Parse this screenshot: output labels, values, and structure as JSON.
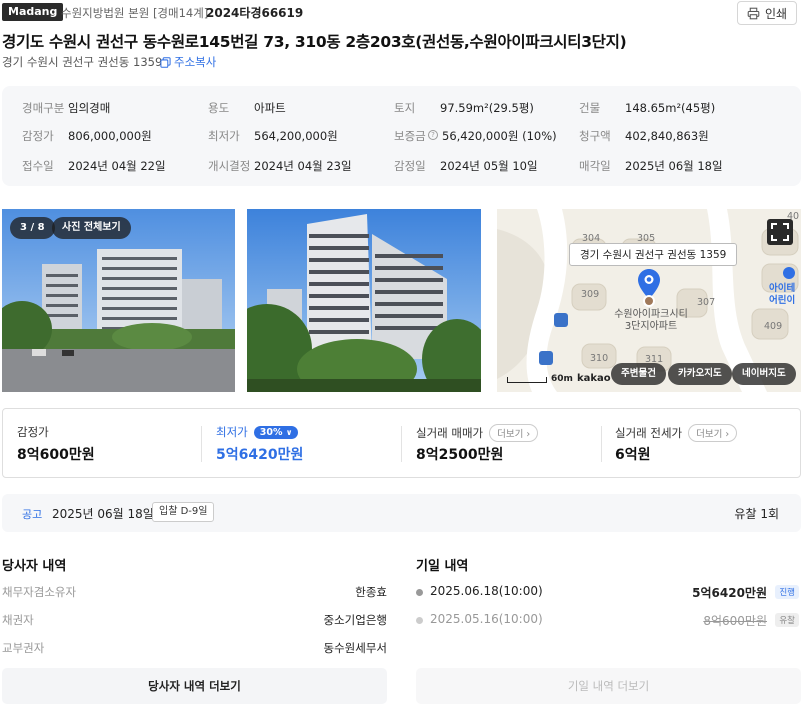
{
  "header": {
    "brand": "Madang",
    "court": "수원지방법원 본원 [경매14계]",
    "case_no": "2024타경66619",
    "print_label": "인쇄"
  },
  "address": {
    "title": "경기도 수원시 권선구 동수원로145번길 73, 310동 2층203호(권선동,수원아이파크시티3단지)",
    "lot": "경기 수원시 권선구 권선동 1359",
    "copy_label": "주소복사"
  },
  "info": [
    [
      {
        "k": "경매구분",
        "v": "임의경매"
      },
      {
        "k": "용도",
        "v": "아파트"
      },
      {
        "k": "토지",
        "v": "97.59m²(29.5평)"
      },
      {
        "k": "건물",
        "v": "148.65m²(45평)"
      }
    ],
    [
      {
        "k": "감정가",
        "v": "806,000,000원"
      },
      {
        "k": "최저가",
        "v": "564,200,000원"
      },
      {
        "k": "보증금",
        "v": "56,420,000원 (10%)"
      },
      {
        "k": "청구액",
        "v": "402,840,863원"
      }
    ],
    [
      {
        "k": "접수일",
        "v": "2024년 04월 22일"
      },
      {
        "k": "개시결정",
        "v": "2024년 04월 23일"
      },
      {
        "k": "감정일",
        "v": "2024년 05월 10일"
      },
      {
        "k": "매각일",
        "v": "2025년 06월 18일"
      }
    ]
  ],
  "photos": {
    "counter": "3 / 8",
    "view_all": "사진 전체보기"
  },
  "map": {
    "address_label": "경기 수원시 권선구 권선동 1359",
    "place_name_line1": "수원아이파크시티",
    "place_name_line2": "3단지아파트",
    "numbers": [
      "304",
      "305",
      "309",
      "307",
      "310",
      "311",
      "409",
      "40"
    ],
    "scale": "60m",
    "provider": "kakao",
    "poi_line1": "아이테",
    "poi_line2": "어린이",
    "buttons": [
      "주변물건",
      "카카오지도",
      "네이버지도"
    ]
  },
  "prices": {
    "appraisal_label": "감정가",
    "appraisal_value": "8억600만원",
    "min_label": "최저가",
    "min_pct": "30%",
    "min_value": "5억6420만원",
    "sale_label": "실거래 매매가",
    "sale_value": "8억2500만원",
    "rent_label": "실거래 전세가",
    "rent_value": "6억원",
    "more_label": "더보기"
  },
  "notice": {
    "label": "공고",
    "date": "2025년 06월 18일",
    "dday": "입찰 D-9일",
    "fail_count": "유찰 1회"
  },
  "parties": {
    "title": "당사자 내역",
    "rows": [
      {
        "k": "채무자겸소유자",
        "v": "한종효"
      },
      {
        "k": "채권자",
        "v": "중소기업은행"
      },
      {
        "k": "교부권자",
        "v": "동수원세무서"
      }
    ],
    "more_button": "당사자 내역 더보기"
  },
  "history": {
    "title": "기일 내역",
    "rows": [
      {
        "date": "2025.06.18(10:00)",
        "price": "5억6420만원",
        "tag": "진행"
      },
      {
        "date": "2025.05.16(10:00)",
        "price": "8억600만원",
        "tag": "유찰"
      }
    ],
    "more_button": "기일 내역 더보기"
  },
  "colors": {
    "accent": "#2f6fe4",
    "panel": "#f6f7f9"
  }
}
